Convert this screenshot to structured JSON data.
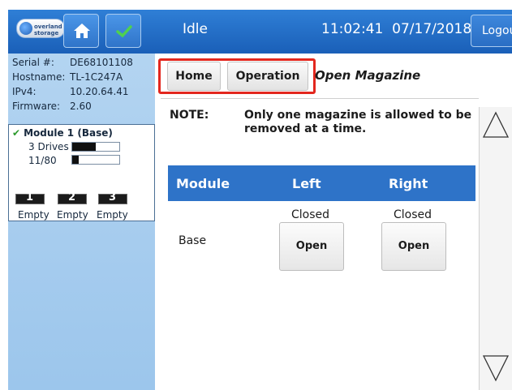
{
  "header": {
    "logo_text": "overland storage",
    "status": "Idle",
    "time": "11:02:41",
    "date": "07/17/2018",
    "logout_label": "Logout",
    "icons": [
      "home-icon",
      "check-icon"
    ]
  },
  "library_info": {
    "serial_label": "Serial #:",
    "serial_value": "DE68101108",
    "hostname_label": "Hostname:",
    "hostname_value": "TL-1C247A",
    "ipv4_label": "IPv4:",
    "ipv4_value": "10.20.64.41",
    "firmware_label": "Firmware:",
    "firmware_value": "2.60"
  },
  "module": {
    "title": "Module 1 (Base)",
    "drives_label": "3 Drives",
    "drives_fill": 0.5,
    "slots_label": "11/80",
    "slots_fill": 0.14,
    "magazines": [
      {
        "number": "1",
        "status": "Empty"
      },
      {
        "number": "2",
        "status": "Empty"
      },
      {
        "number": "3",
        "status": "Empty"
      }
    ]
  },
  "nav": {
    "home_label": "Home",
    "operation_label": "Operation",
    "current_page": "Open Magazine",
    "highlight_color": "#e3271e"
  },
  "note": {
    "label": "NOTE:",
    "text": "Only one magazine is allowed to be removed at a time."
  },
  "table": {
    "headers": [
      "Module",
      "Left",
      "Right"
    ],
    "rows": [
      {
        "module": "Base",
        "left_status": "Closed",
        "right_status": "Closed",
        "left_button": "Open",
        "right_button": "Open"
      }
    ],
    "header_color": "#2e73c8"
  },
  "scrollbar": {
    "up_icon": "triangle-up-icon",
    "down_icon": "triangle-down-icon"
  }
}
